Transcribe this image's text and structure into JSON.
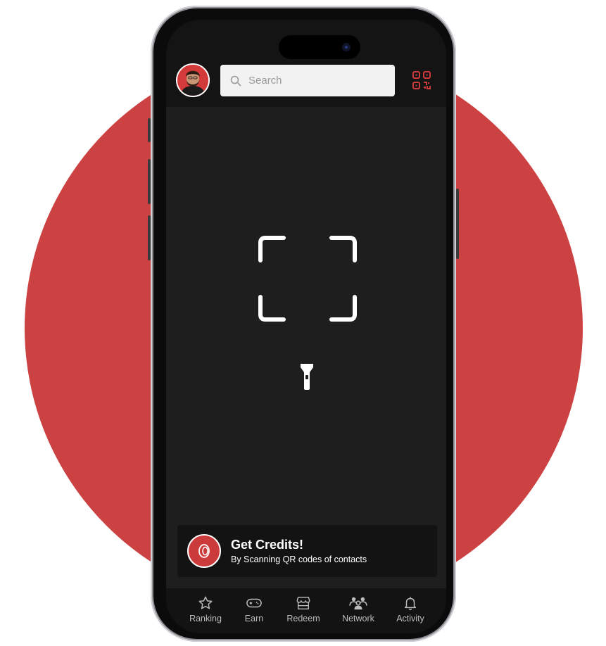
{
  "header": {
    "avatar_alt": "User avatar",
    "search_placeholder": "Search"
  },
  "scanner": {
    "viewfinder_icon": "qr-viewfinder",
    "torch_icon": "flashlight-icon"
  },
  "credits_card": {
    "title": "Get Credits!",
    "subtitle": "By Scanning QR codes of contacts"
  },
  "tabs": [
    {
      "label": "Ranking",
      "icon": "star-icon"
    },
    {
      "label": "Earn",
      "icon": "gamepad-icon"
    },
    {
      "label": "Redeem",
      "icon": "store-icon"
    },
    {
      "label": "Network",
      "icon": "people-icon"
    },
    {
      "label": "Activity",
      "icon": "bell-icon"
    }
  ],
  "colors": {
    "accent": "#cc4242",
    "header_bg": "#141414",
    "screen_bg": "#1e1e1e"
  }
}
